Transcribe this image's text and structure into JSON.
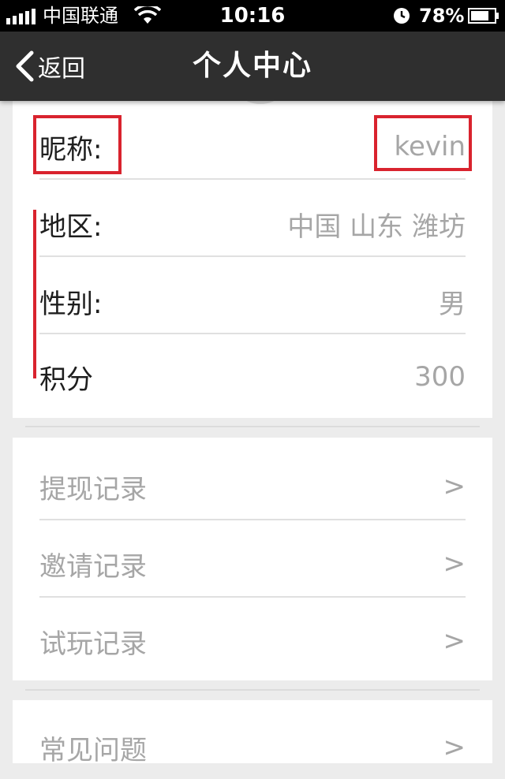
{
  "status_bar": {
    "carrier": "中国联通",
    "time": "10:16",
    "battery": "78%",
    "icons": [
      "signal-icon",
      "wifi-icon",
      "clock-icon",
      "battery-icon"
    ]
  },
  "nav": {
    "back_label": "返回",
    "title": "个人中心",
    "back_icon": "chevron-left-icon"
  },
  "profile": {
    "nickname": {
      "label": "昵称:",
      "value": "kevin"
    },
    "region": {
      "label": "地区:",
      "value": "中国 山东 潍坊"
    },
    "gender": {
      "label": "性别:",
      "value": "男"
    },
    "points": {
      "label": "积分",
      "value": "300"
    }
  },
  "records": [
    {
      "label": "提现记录",
      "chevron": ">"
    },
    {
      "label": "邀请记录",
      "chevron": ">"
    },
    {
      "label": "试玩记录",
      "chevron": ">"
    }
  ],
  "faq": {
    "label": "常见问题",
    "chevron": ">"
  },
  "colors": {
    "nav_bg": "#2f2f2f",
    "annotation_red": "#d9232e",
    "value_gray": "#a6a6a6"
  }
}
